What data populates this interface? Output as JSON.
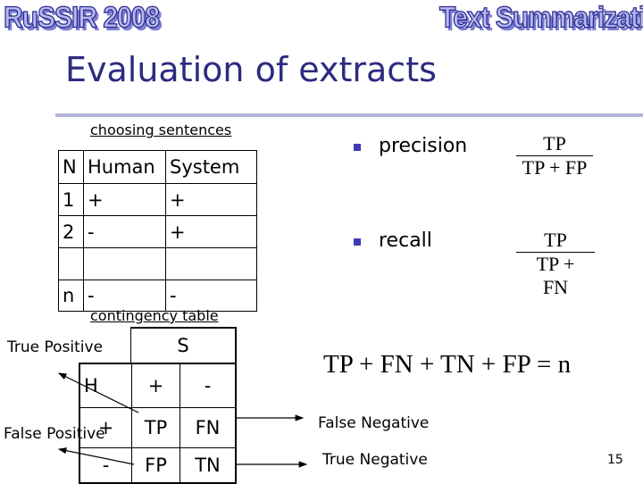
{
  "header": {
    "left_logo": "RuSSIR 2008",
    "right_logo": "Text Summarization"
  },
  "slide": {
    "title": "Evaluation of extracts",
    "page_number": "15"
  },
  "sentence_table": {
    "caption": "choosing sentences",
    "headers": [
      "N",
      "Human",
      "System"
    ],
    "rows": [
      [
        "1",
        "+",
        "+"
      ],
      [
        "2",
        "-",
        "+"
      ],
      [
        "",
        "",
        ""
      ],
      [
        "n",
        "-",
        "-"
      ]
    ]
  },
  "contingency_table": {
    "caption": "contingency table",
    "system_header": "S",
    "human_header": "H",
    "col_labels": [
      "+",
      "-"
    ],
    "row_labels": [
      "+",
      "-"
    ],
    "cells": [
      [
        "TP",
        "FN"
      ],
      [
        "FP",
        "TN"
      ]
    ]
  },
  "annotations": {
    "true_positive": "True Positive",
    "false_positive": "False Positive",
    "false_negative": "False Negative",
    "true_negative": "True Negative"
  },
  "bullets": [
    {
      "label": "precision",
      "numerator": "TP",
      "denominator": "TP + FP"
    },
    {
      "label": "recall",
      "numerator": "TP",
      "denominator": "TP + FN"
    }
  ],
  "equation": "TP + FN + TN + FP = n"
}
